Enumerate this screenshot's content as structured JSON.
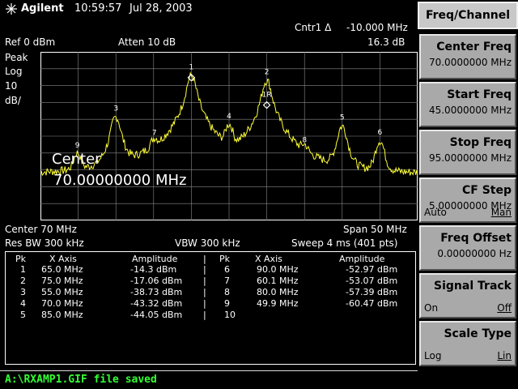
{
  "header": {
    "brand": "Agilent",
    "time": "10:59:57",
    "date": "Jul 28, 2003"
  },
  "screen": {
    "marker_readout_label": "Cntr1 Δ",
    "marker_readout_freq": "-10.000 MHz",
    "marker_readout_amp": "16.3 dB",
    "ref_level": "Ref 0 dBm",
    "atten": "Atten 10 dB",
    "detector": "Peak",
    "scale_type": "Log",
    "scale_value": "10",
    "scale_unit": "dB/",
    "center_overlay_label": "Center",
    "center_overlay_value": "70.00000000 MHz",
    "center_freq": "Center 70 MHz",
    "span": "Span 50 MHz",
    "res_bw": "Res BW 300 kHz",
    "vbw": "VBW 300 kHz",
    "sweep": "Sweep 4 ms (401 pts)"
  },
  "markers": [
    {
      "id": "1",
      "freq": 65.0,
      "amp": -14.3
    },
    {
      "id": "2",
      "freq": 75.0,
      "amp": -17.06
    },
    {
      "id": "3",
      "freq": 55.0,
      "amp": -38.73
    },
    {
      "id": "4",
      "freq": 70.0,
      "amp": -43.32
    },
    {
      "id": "5",
      "freq": 85.0,
      "amp": -44.05
    },
    {
      "id": "6",
      "freq": 90.0,
      "amp": -52.97
    },
    {
      "id": "7",
      "freq": 60.1,
      "amp": -53.07
    },
    {
      "id": "8",
      "freq": 80.0,
      "amp": -57.39
    },
    {
      "id": "9",
      "freq": 49.9,
      "amp": -60.47
    },
    {
      "id": "1R",
      "freq": 75.0,
      "amp": -30.6
    }
  ],
  "chart_data": {
    "type": "line",
    "xlim": [
      45,
      95
    ],
    "ylim": [
      -100,
      0
    ],
    "noise_floor": -72,
    "peaks": [
      {
        "x": 49.9,
        "y": -60.47
      },
      {
        "x": 55.0,
        "y": -38.73
      },
      {
        "x": 60.1,
        "y": -53.07
      },
      {
        "x": 65.0,
        "y": -14.3
      },
      {
        "x": 70.0,
        "y": -43.32
      },
      {
        "x": 75.0,
        "y": -17.06
      },
      {
        "x": 80.0,
        "y": -57.39
      },
      {
        "x": 85.0,
        "y": -44.05
      },
      {
        "x": 90.0,
        "y": -52.97
      }
    ],
    "trace_color": "#ffff33",
    "grid": true
  },
  "table": {
    "headers": {
      "pk": "Pk",
      "x": "X Axis",
      "amp": "Amplitude",
      "sep": "|"
    },
    "rows": [
      {
        "l_pk": "1",
        "l_x": "65.0 MHz",
        "l_amp": "-14.3 dBm",
        "r_pk": "6",
        "r_x": "90.0 MHz",
        "r_amp": "-52.97 dBm"
      },
      {
        "l_pk": "2",
        "l_x": "75.0 MHz",
        "l_amp": "-17.06 dBm",
        "r_pk": "7",
        "r_x": "60.1 MHz",
        "r_amp": "-53.07 dBm"
      },
      {
        "l_pk": "3",
        "l_x": "55.0 MHz",
        "l_amp": "-38.73 dBm",
        "r_pk": "8",
        "r_x": "80.0 MHz",
        "r_amp": "-57.39 dBm"
      },
      {
        "l_pk": "4",
        "l_x": "70.0 MHz",
        "l_amp": "-43.32 dBm",
        "r_pk": "9",
        "r_x": "49.9 MHz",
        "r_amp": "-60.47 dBm"
      },
      {
        "l_pk": "5",
        "l_x": "85.0 MHz",
        "l_amp": "-44.05 dBm",
        "r_pk": "10",
        "r_x": "",
        "r_amp": ""
      }
    ]
  },
  "menu": {
    "title": "Freq/Channel",
    "keys": [
      {
        "label": "Center Freq",
        "value": "70.0000000 MHz",
        "left": "",
        "right": ""
      },
      {
        "label": "Start Freq",
        "value": "45.0000000 MHz",
        "left": "",
        "right": ""
      },
      {
        "label": "Stop Freq",
        "value": "95.0000000 MHz",
        "left": "",
        "right": ""
      },
      {
        "label": "CF Step",
        "value": "5.00000000 MHz",
        "left": "Auto",
        "right": "Man"
      },
      {
        "label": "Freq Offset",
        "value": "0.00000000 Hz",
        "left": "",
        "right": ""
      },
      {
        "label": "Signal Track",
        "value": "",
        "left": "On",
        "right": "Off"
      },
      {
        "label": "Scale Type",
        "value": "",
        "left": "Log",
        "right": "Lin"
      }
    ]
  },
  "status": {
    "message": "A:\\RXAMP1.GIF file saved"
  }
}
